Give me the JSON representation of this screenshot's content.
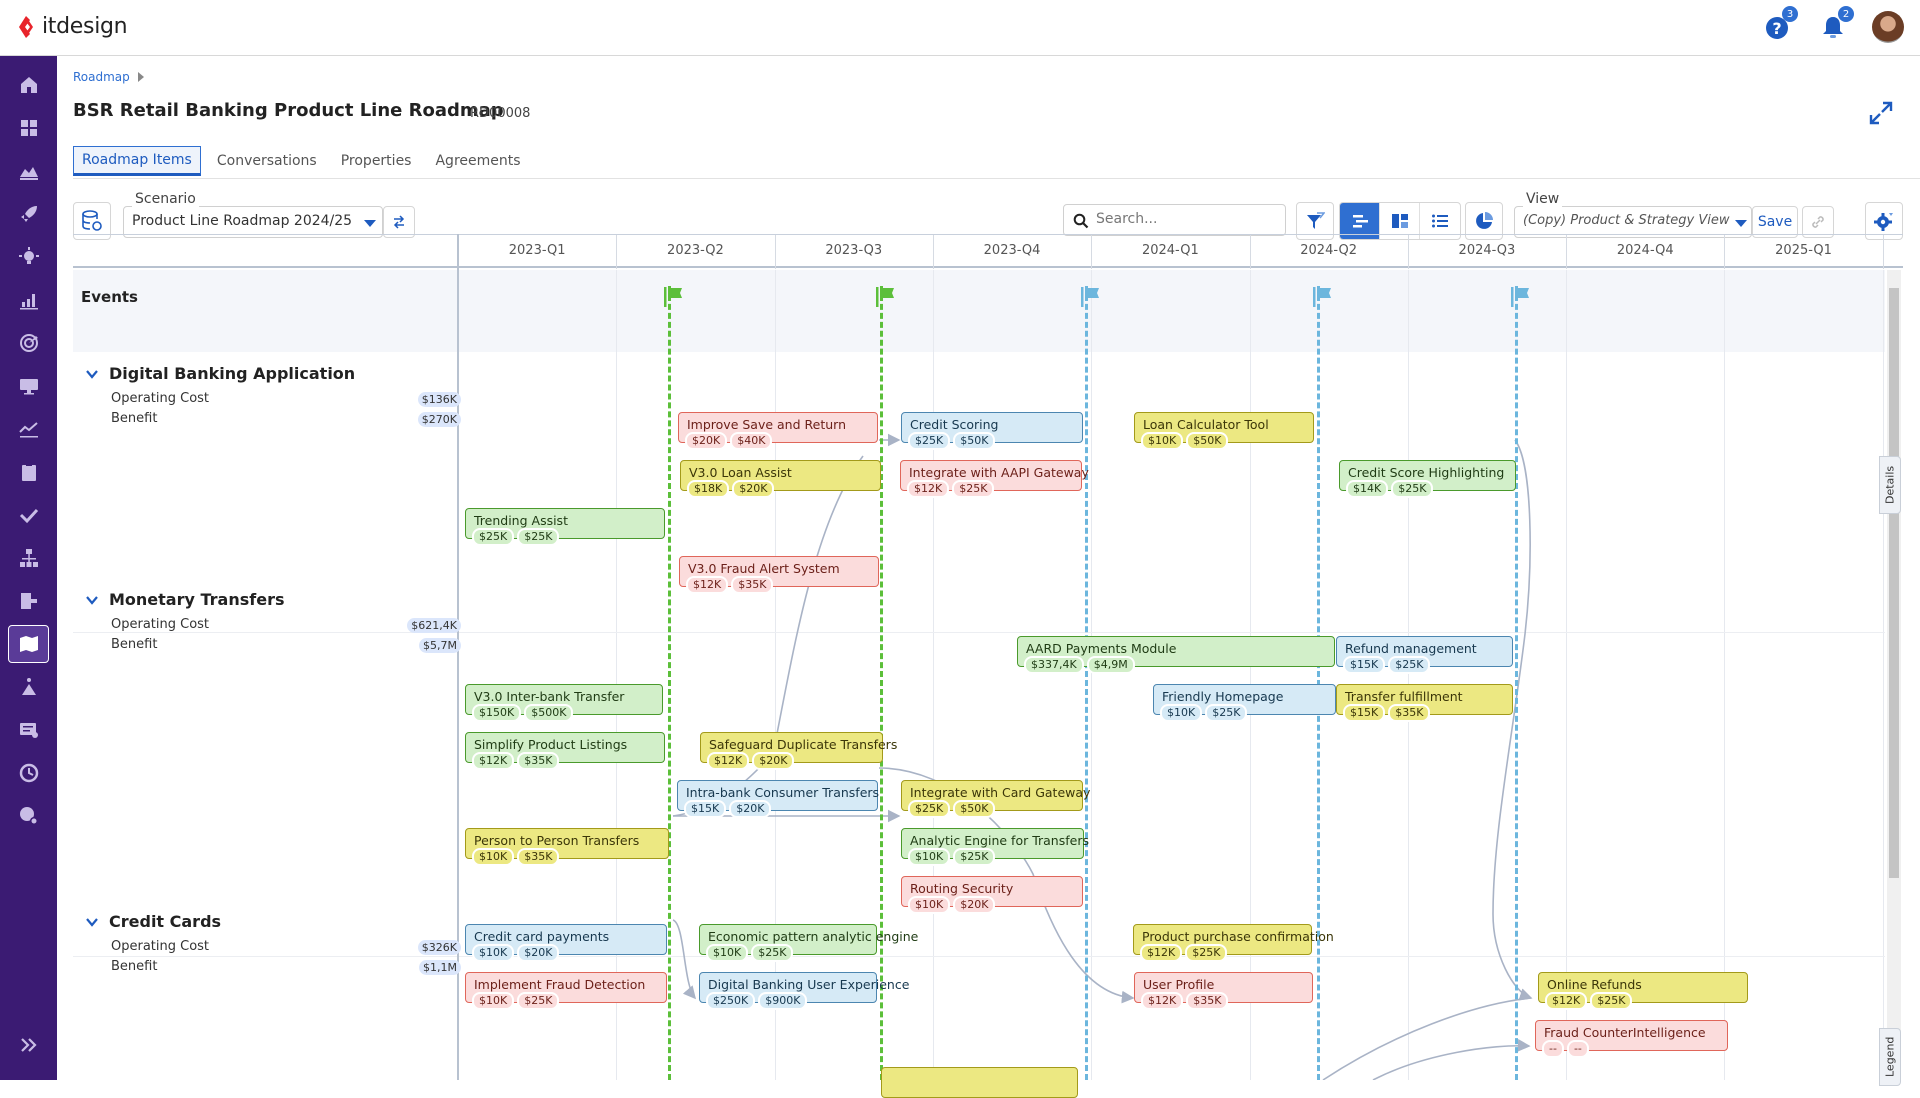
{
  "app": {
    "brand": "itdesign",
    "help_badge": "3",
    "notifications_badge": "2"
  },
  "breadcrumb": {
    "items": [
      "Roadmap"
    ]
  },
  "page": {
    "title": "BSR Retail Banking Product Line Roadmap",
    "id": "RD00008"
  },
  "tabs": [
    {
      "label": "Roadmap Items",
      "active": true
    },
    {
      "label": "Conversations",
      "active": false
    },
    {
      "label": "Properties",
      "active": false
    },
    {
      "label": "Agreements",
      "active": false
    }
  ],
  "toolbar": {
    "scenario_label": "Scenario",
    "scenario_value": "Product Line Roadmap 2024/25",
    "search_placeholder": "Search...",
    "view_label": "View",
    "view_value": "(Copy) Product & Strategy View",
    "save_label": "Save"
  },
  "timeline": {
    "quarters": [
      "2023-Q1",
      "2023-Q2",
      "2023-Q3",
      "2023-Q4",
      "2024-Q1",
      "2024-Q2",
      "2024-Q3",
      "2024-Q4",
      "2025-Q1"
    ],
    "events_label": "Events",
    "events": [
      {
        "color": "#5cbf3a"
      },
      {
        "color": "#5cbf3a"
      },
      {
        "color": "#6cb6dd"
      },
      {
        "color": "#6cb6dd"
      },
      {
        "color": "#6cb6dd"
      }
    ]
  },
  "groups": [
    {
      "title": "Digital Banking Application",
      "cost_label": "Operating Cost",
      "cost": "$136K",
      "benefit_label": "Benefit",
      "benefit": "$270K"
    },
    {
      "title": "Monetary Transfers",
      "cost_label": "Operating Cost",
      "cost": "$621,4K",
      "benefit_label": "Benefit",
      "benefit": "$5,7M"
    },
    {
      "title": "Credit Cards",
      "cost_label": "Operating Cost",
      "cost": "$326K",
      "benefit_label": "Benefit",
      "benefit": "$1,1M"
    }
  ],
  "items": [
    {
      "title": "Improve Save and Return",
      "cost": "$20K",
      "benefit": "$40K",
      "color": "red"
    },
    {
      "title": "V3.0 Loan Assist",
      "cost": "$18K",
      "benefit": "$20K",
      "color": "yellow"
    },
    {
      "title": "Trending Assist",
      "cost": "$25K",
      "benefit": "$25K",
      "color": "green"
    },
    {
      "title": "V3.0 Fraud Alert System",
      "cost": "$12K",
      "benefit": "$35K",
      "color": "red"
    },
    {
      "title": "Credit Scoring",
      "cost": "$25K",
      "benefit": "$50K",
      "color": "blue"
    },
    {
      "title": "Integrate with AAPI Gateway",
      "cost": "$12K",
      "benefit": "$25K",
      "color": "red"
    },
    {
      "title": "Loan Calculator Tool",
      "cost": "$10K",
      "benefit": "$50K",
      "color": "yellow"
    },
    {
      "title": "Credit Score Highlighting",
      "cost": "$14K",
      "benefit": "$25K",
      "color": "green"
    },
    {
      "title": "AARD Payments Module",
      "cost": "$337,4K",
      "benefit": "$4,9M",
      "color": "green"
    },
    {
      "title": "Refund management",
      "cost": "$15K",
      "benefit": "$25K",
      "color": "blue"
    },
    {
      "title": "V3.0 Inter-bank Transfer",
      "cost": "$150K",
      "benefit": "$500K",
      "color": "green"
    },
    {
      "title": "Friendly Homepage",
      "cost": "$10K",
      "benefit": "$25K",
      "color": "blue"
    },
    {
      "title": "Transfer fulfillment",
      "cost": "$15K",
      "benefit": "$35K",
      "color": "yellow"
    },
    {
      "title": "Simplify Product Listings",
      "cost": "$12K",
      "benefit": "$35K",
      "color": "green"
    },
    {
      "title": "Safeguard Duplicate Transfers",
      "cost": "$12K",
      "benefit": "$20K",
      "color": "yellow"
    },
    {
      "title": "Intra-bank Consumer Transfers",
      "cost": "$15K",
      "benefit": "$20K",
      "color": "blue"
    },
    {
      "title": "Integrate with Card Gateway",
      "cost": "$25K",
      "benefit": "$50K",
      "color": "yellow"
    },
    {
      "title": "Person to Person Transfers",
      "cost": "$10K",
      "benefit": "$35K",
      "color": "yellow"
    },
    {
      "title": "Analytic Engine for Transfers",
      "cost": "$10K",
      "benefit": "$25K",
      "color": "green"
    },
    {
      "title": "Routing Security",
      "cost": "$10K",
      "benefit": "$20K",
      "color": "red"
    },
    {
      "title": "Credit card payments",
      "cost": "$10K",
      "benefit": "$20K",
      "color": "blue"
    },
    {
      "title": "Economic pattern analytic engine",
      "cost": "$10K",
      "benefit": "$25K",
      "color": "green"
    },
    {
      "title": "Product purchase confirmation",
      "cost": "$12K",
      "benefit": "$25K",
      "color": "yellow"
    },
    {
      "title": "Implement Fraud Detection",
      "cost": "$10K",
      "benefit": "$25K",
      "color": "red"
    },
    {
      "title": "Digital Banking User Experience",
      "cost": "$250K",
      "benefit": "$900K",
      "color": "blue"
    },
    {
      "title": "User Profile",
      "cost": "$12K",
      "benefit": "$35K",
      "color": "red"
    },
    {
      "title": "Online Refunds",
      "cost": "$12K",
      "benefit": "$25K",
      "color": "yellow"
    },
    {
      "title": "Fraud CounterIntelligence",
      "cost": "--",
      "benefit": "--",
      "color": "red"
    },
    {
      "title": "",
      "cost": "",
      "benefit": "",
      "color": "yellow"
    }
  ],
  "side_tabs": {
    "details": "Details",
    "legend": "Legend"
  }
}
